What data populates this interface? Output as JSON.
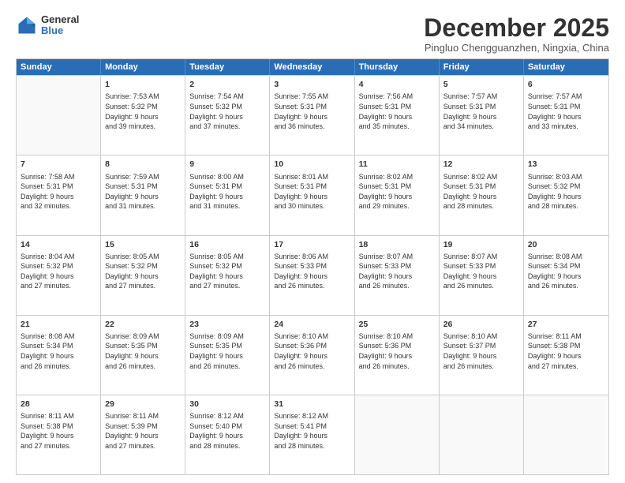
{
  "logo": {
    "general": "General",
    "blue": "Blue"
  },
  "title": "December 2025",
  "subtitle": "Pingluo Chengguanzhen, Ningxia, China",
  "header_days": [
    "Sunday",
    "Monday",
    "Tuesday",
    "Wednesday",
    "Thursday",
    "Friday",
    "Saturday"
  ],
  "rows": [
    [
      {
        "day": "",
        "lines": []
      },
      {
        "day": "1",
        "lines": [
          "Sunrise: 7:53 AM",
          "Sunset: 5:32 PM",
          "Daylight: 9 hours",
          "and 39 minutes."
        ]
      },
      {
        "day": "2",
        "lines": [
          "Sunrise: 7:54 AM",
          "Sunset: 5:32 PM",
          "Daylight: 9 hours",
          "and 37 minutes."
        ]
      },
      {
        "day": "3",
        "lines": [
          "Sunrise: 7:55 AM",
          "Sunset: 5:31 PM",
          "Daylight: 9 hours",
          "and 36 minutes."
        ]
      },
      {
        "day": "4",
        "lines": [
          "Sunrise: 7:56 AM",
          "Sunset: 5:31 PM",
          "Daylight: 9 hours",
          "and 35 minutes."
        ]
      },
      {
        "day": "5",
        "lines": [
          "Sunrise: 7:57 AM",
          "Sunset: 5:31 PM",
          "Daylight: 9 hours",
          "and 34 minutes."
        ]
      },
      {
        "day": "6",
        "lines": [
          "Sunrise: 7:57 AM",
          "Sunset: 5:31 PM",
          "Daylight: 9 hours",
          "and 33 minutes."
        ]
      }
    ],
    [
      {
        "day": "7",
        "lines": [
          "Sunrise: 7:58 AM",
          "Sunset: 5:31 PM",
          "Daylight: 9 hours",
          "and 32 minutes."
        ]
      },
      {
        "day": "8",
        "lines": [
          "Sunrise: 7:59 AM",
          "Sunset: 5:31 PM",
          "Daylight: 9 hours",
          "and 31 minutes."
        ]
      },
      {
        "day": "9",
        "lines": [
          "Sunrise: 8:00 AM",
          "Sunset: 5:31 PM",
          "Daylight: 9 hours",
          "and 31 minutes."
        ]
      },
      {
        "day": "10",
        "lines": [
          "Sunrise: 8:01 AM",
          "Sunset: 5:31 PM",
          "Daylight: 9 hours",
          "and 30 minutes."
        ]
      },
      {
        "day": "11",
        "lines": [
          "Sunrise: 8:02 AM",
          "Sunset: 5:31 PM",
          "Daylight: 9 hours",
          "and 29 minutes."
        ]
      },
      {
        "day": "12",
        "lines": [
          "Sunrise: 8:02 AM",
          "Sunset: 5:31 PM",
          "Daylight: 9 hours",
          "and 28 minutes."
        ]
      },
      {
        "day": "13",
        "lines": [
          "Sunrise: 8:03 AM",
          "Sunset: 5:32 PM",
          "Daylight: 9 hours",
          "and 28 minutes."
        ]
      }
    ],
    [
      {
        "day": "14",
        "lines": [
          "Sunrise: 8:04 AM",
          "Sunset: 5:32 PM",
          "Daylight: 9 hours",
          "and 27 minutes."
        ]
      },
      {
        "day": "15",
        "lines": [
          "Sunrise: 8:05 AM",
          "Sunset: 5:32 PM",
          "Daylight: 9 hours",
          "and 27 minutes."
        ]
      },
      {
        "day": "16",
        "lines": [
          "Sunrise: 8:05 AM",
          "Sunset: 5:32 PM",
          "Daylight: 9 hours",
          "and 27 minutes."
        ]
      },
      {
        "day": "17",
        "lines": [
          "Sunrise: 8:06 AM",
          "Sunset: 5:33 PM",
          "Daylight: 9 hours",
          "and 26 minutes."
        ]
      },
      {
        "day": "18",
        "lines": [
          "Sunrise: 8:07 AM",
          "Sunset: 5:33 PM",
          "Daylight: 9 hours",
          "and 26 minutes."
        ]
      },
      {
        "day": "19",
        "lines": [
          "Sunrise: 8:07 AM",
          "Sunset: 5:33 PM",
          "Daylight: 9 hours",
          "and 26 minutes."
        ]
      },
      {
        "day": "20",
        "lines": [
          "Sunrise: 8:08 AM",
          "Sunset: 5:34 PM",
          "Daylight: 9 hours",
          "and 26 minutes."
        ]
      }
    ],
    [
      {
        "day": "21",
        "lines": [
          "Sunrise: 8:08 AM",
          "Sunset: 5:34 PM",
          "Daylight: 9 hours",
          "and 26 minutes."
        ]
      },
      {
        "day": "22",
        "lines": [
          "Sunrise: 8:09 AM",
          "Sunset: 5:35 PM",
          "Daylight: 9 hours",
          "and 26 minutes."
        ]
      },
      {
        "day": "23",
        "lines": [
          "Sunrise: 8:09 AM",
          "Sunset: 5:35 PM",
          "Daylight: 9 hours",
          "and 26 minutes."
        ]
      },
      {
        "day": "24",
        "lines": [
          "Sunrise: 8:10 AM",
          "Sunset: 5:36 PM",
          "Daylight: 9 hours",
          "and 26 minutes."
        ]
      },
      {
        "day": "25",
        "lines": [
          "Sunrise: 8:10 AM",
          "Sunset: 5:36 PM",
          "Daylight: 9 hours",
          "and 26 minutes."
        ]
      },
      {
        "day": "26",
        "lines": [
          "Sunrise: 8:10 AM",
          "Sunset: 5:37 PM",
          "Daylight: 9 hours",
          "and 26 minutes."
        ]
      },
      {
        "day": "27",
        "lines": [
          "Sunrise: 8:11 AM",
          "Sunset: 5:38 PM",
          "Daylight: 9 hours",
          "and 27 minutes."
        ]
      }
    ],
    [
      {
        "day": "28",
        "lines": [
          "Sunrise: 8:11 AM",
          "Sunset: 5:38 PM",
          "Daylight: 9 hours",
          "and 27 minutes."
        ]
      },
      {
        "day": "29",
        "lines": [
          "Sunrise: 8:11 AM",
          "Sunset: 5:39 PM",
          "Daylight: 9 hours",
          "and 27 minutes."
        ]
      },
      {
        "day": "30",
        "lines": [
          "Sunrise: 8:12 AM",
          "Sunset: 5:40 PM",
          "Daylight: 9 hours",
          "and 28 minutes."
        ]
      },
      {
        "day": "31",
        "lines": [
          "Sunrise: 8:12 AM",
          "Sunset: 5:41 PM",
          "Daylight: 9 hours",
          "and 28 minutes."
        ]
      },
      {
        "day": "",
        "lines": []
      },
      {
        "day": "",
        "lines": []
      },
      {
        "day": "",
        "lines": []
      }
    ]
  ]
}
